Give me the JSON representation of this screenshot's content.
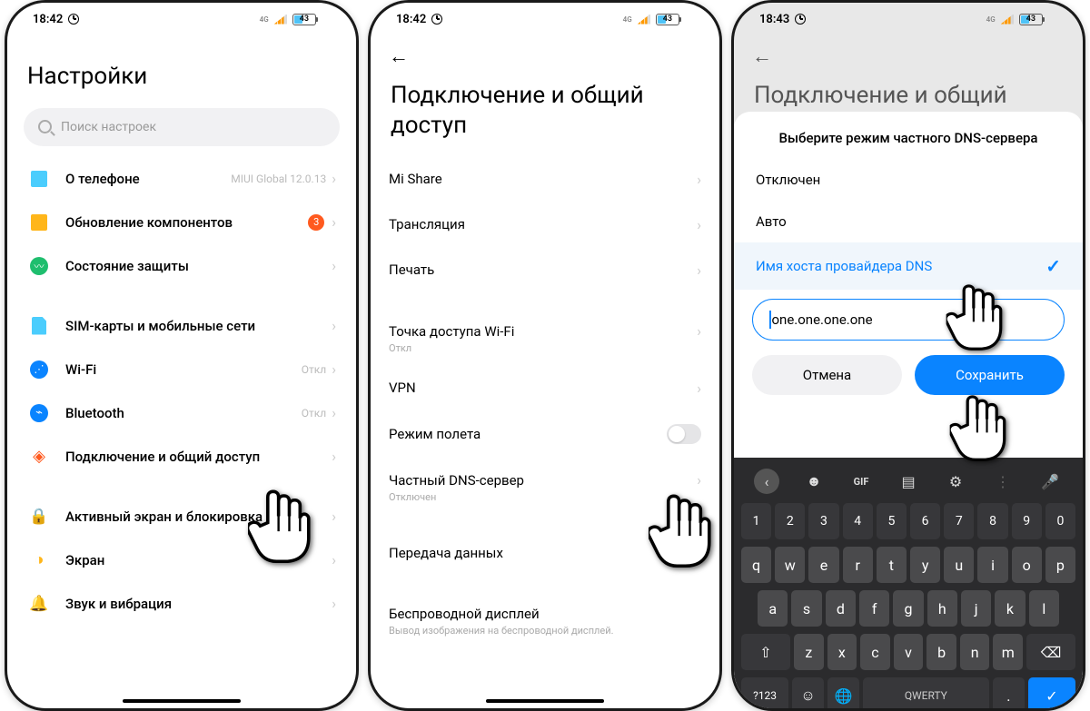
{
  "status": {
    "time1": "18:42",
    "time2": "18:42",
    "time3": "18:43",
    "battery": "43",
    "signal_label": "4G"
  },
  "p1": {
    "title": "Настройки",
    "search_placeholder": "Поиск настроек",
    "rows": {
      "about": "О телефоне",
      "about_right": "MIUI Global 12.0.13",
      "updates": "Обновление компонентов",
      "updates_badge": "3",
      "security": "Состояние защиты",
      "sim": "SIM-карты и мобильные сети",
      "wifi": "Wi-Fi",
      "wifi_right": "Откл",
      "bt": "Bluetooth",
      "bt_right": "Откл",
      "connect": "Подключение и общий доступ",
      "aod": "Активный экран и блокировка",
      "display": "Экран",
      "sound": "Звук и вибрация"
    }
  },
  "p2": {
    "title": "Подключение и общий доступ",
    "rows": {
      "mishare": "Mi Share",
      "cast": "Трансляция",
      "print": "Печать",
      "hotspot": "Точка доступа Wi-Fi",
      "hotspot_sub": "Откл",
      "vpn": "VPN",
      "airplane": "Режим полета",
      "dns": "Частный DNS-сервер",
      "dns_sub": "Отключен",
      "data": "Передача данных",
      "wdisplay": "Беспроводной дисплей",
      "wdisplay_sub": "Вывод изображения на беспроводной дисплей."
    }
  },
  "p3": {
    "title": "Подключение и общий",
    "sheet_title": "Выберите режим частного DNS-сервера",
    "opts": {
      "off": "Отключен",
      "auto": "Авто",
      "host": "Имя хоста провайдера DNS"
    },
    "input_value": "one.one.one.one",
    "cancel": "Отмена",
    "save": "Сохранить"
  },
  "keyboard": {
    "gif": "GIF",
    "space": "QWERTY",
    "sym": "?123",
    "numrow": [
      "1",
      "2",
      "3",
      "4",
      "5",
      "6",
      "7",
      "8",
      "9",
      "0"
    ],
    "row1": [
      "q",
      "w",
      "e",
      "r",
      "t",
      "y",
      "u",
      "i",
      "o",
      "p"
    ],
    "row2": [
      "a",
      "s",
      "d",
      "f",
      "g",
      "h",
      "j",
      "k",
      "l"
    ],
    "row3": [
      "z",
      "x",
      "c",
      "v",
      "b",
      "n",
      "m"
    ]
  }
}
